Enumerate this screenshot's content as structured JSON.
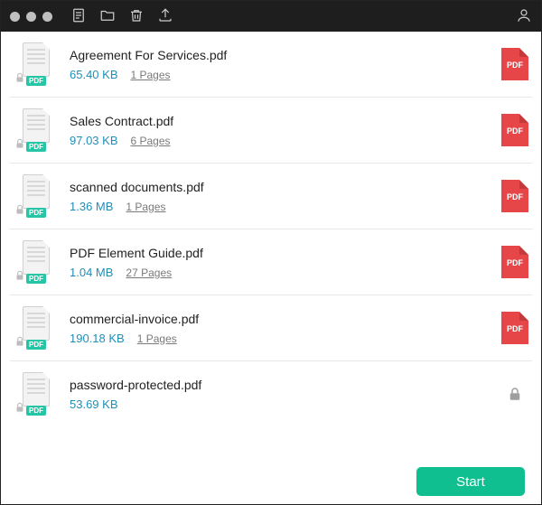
{
  "toolbar": {
    "document_icon": "document-icon",
    "folder_icon": "folder-icon",
    "trash_icon": "trash-icon",
    "export_icon": "export-icon",
    "user_icon": "user-icon"
  },
  "badge_text": "PDF",
  "thumb_tag": "PDF",
  "files": [
    {
      "name": "Agreement For Services.pdf",
      "size": "65.40 KB",
      "pages": "1 Pages",
      "locked": false
    },
    {
      "name": "Sales Contract.pdf",
      "size": "97.03 KB",
      "pages": "6 Pages",
      "locked": false
    },
    {
      "name": "scanned documents.pdf",
      "size": "1.36 MB",
      "pages": "1 Pages",
      "locked": false
    },
    {
      "name": "PDF Element Guide.pdf",
      "size": "1.04 MB",
      "pages": "27 Pages",
      "locked": false
    },
    {
      "name": "commercial-invoice.pdf",
      "size": "190.18 KB",
      "pages": "1 Pages",
      "locked": false
    },
    {
      "name": "password-protected.pdf",
      "size": "53.69 KB",
      "pages": "",
      "locked": true
    }
  ],
  "footer": {
    "start_label": "Start"
  }
}
